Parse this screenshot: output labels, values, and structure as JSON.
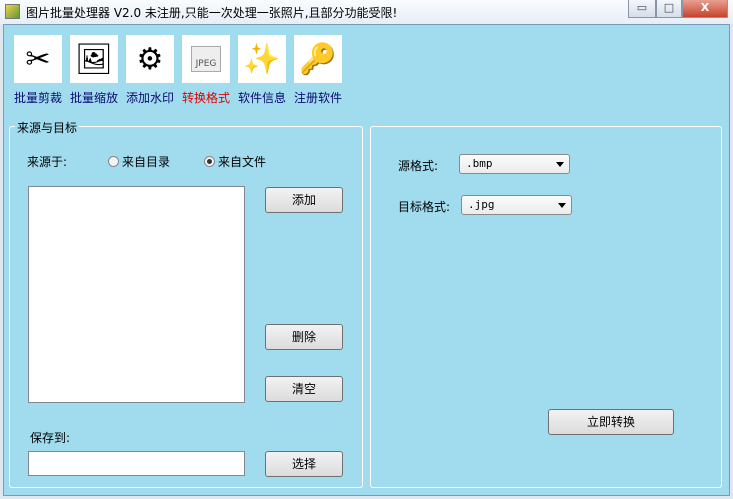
{
  "window": {
    "title": "图片批量处理器 V2.0  未注册,只能一次处理一张照片,且部分功能受限!",
    "minimize": "▭",
    "maximize": "□",
    "close": "X"
  },
  "toolbar": [
    {
      "label": "批量剪裁",
      "icon": "scissors-icon",
      "glyph": "✂"
    },
    {
      "label": "批量缩放",
      "icon": "picture-icon",
      "glyph": "🖼"
    },
    {
      "label": "添加水印",
      "icon": "gear-k-icon",
      "glyph": "⚙"
    },
    {
      "label": "转换格式",
      "icon": "jpeg-file-icon",
      "glyph": "JPEG"
    },
    {
      "label": "软件信息",
      "icon": "magic-wand-icon",
      "glyph": "✨"
    },
    {
      "label": "注册软件",
      "icon": "key-user-icon",
      "glyph": "🔑"
    }
  ],
  "source": {
    "group_title": "来源与目标",
    "source_label": "来源于:",
    "radio_dir": "来自目录",
    "radio_file": "来自文件",
    "selected": "来自文件",
    "add": "添加",
    "delete": "删除",
    "clear": "清空",
    "save_to": "保存到:",
    "save_value": "",
    "choose": "选择"
  },
  "convert": {
    "src_label": "源格式:",
    "src_value": ".bmp",
    "dst_label": "目标格式:",
    "dst_value": ".jpg",
    "convert_now": "立即转换"
  }
}
